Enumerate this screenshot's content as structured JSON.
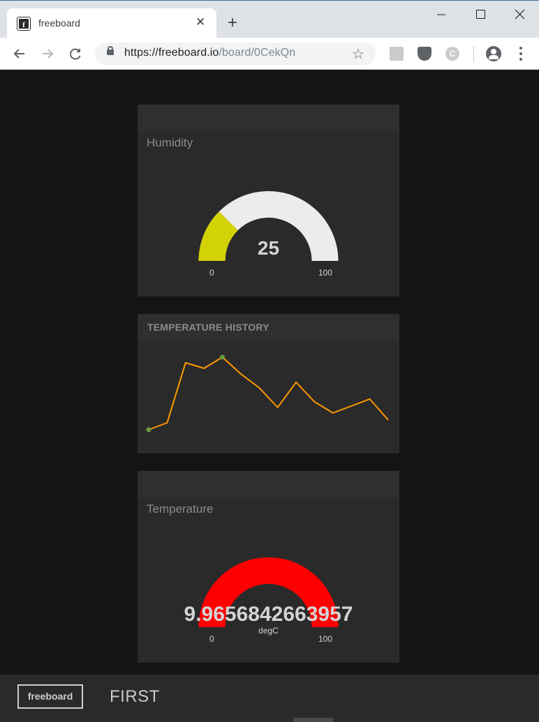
{
  "browser": {
    "tab_title": "freeboard",
    "favicon_letter": "f",
    "close_glyph": "✕",
    "new_tab_glyph": "+",
    "url_host": "https://freeboard.io",
    "url_path": "/board/0CekQn",
    "star_glyph": "☆",
    "ext_c_letter": "C",
    "icons": [
      "back-arrow-icon",
      "forward-arrow-icon",
      "reload-icon",
      "lock-icon",
      "star-icon",
      "pdf-extension-icon",
      "pocket-extension-icon",
      "c-extension-icon",
      "account-icon",
      "menu-icon"
    ]
  },
  "widgets": {
    "humidity": {
      "title": "Humidity",
      "value": "25",
      "min": "0",
      "max": "100",
      "level": 0.25,
      "fill_color": "#d3d205",
      "track_color": "#edebeb"
    },
    "history": {
      "title": "TEMPERATURE HISTORY",
      "values": [
        0,
        2.5,
        24,
        22,
        26,
        20,
        15,
        8,
        17,
        10,
        6,
        8.5,
        11,
        3.5
      ],
      "line_color": "#ff9900",
      "point_color": "#6b9e3c"
    },
    "temperature": {
      "title": "Temperature",
      "value": "9.9656842663957",
      "units": "degC",
      "min": "0",
      "max": "100",
      "level": 0.0996568,
      "fill_color": "#ff0000",
      "track_color": "#ff0000"
    }
  },
  "footer": {
    "logo_text": "freeboard",
    "board_name": "FIRST"
  }
}
